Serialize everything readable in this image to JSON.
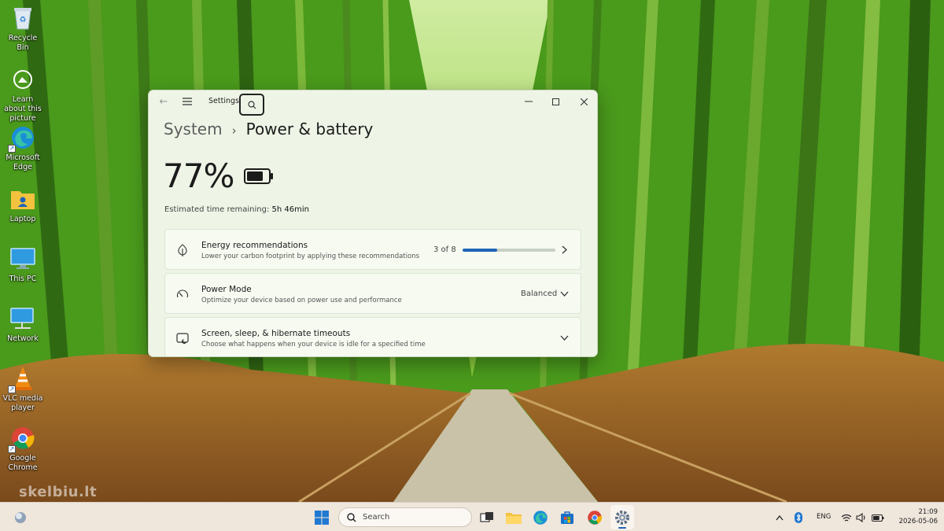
{
  "desktop": {
    "icons": [
      {
        "label": "Recycle Bin"
      },
      {
        "label": "Learn about this picture"
      },
      {
        "label": "Microsoft Edge"
      },
      {
        "label": "Laptop"
      },
      {
        "label": "This PC"
      },
      {
        "label": "Network"
      },
      {
        "label": "VLC media player"
      },
      {
        "label": "Google Chrome"
      }
    ],
    "watermark": "skelbiu.lt"
  },
  "window": {
    "app_title": "Settings",
    "breadcrumb": {
      "parent": "System",
      "separator": "›",
      "current": "Power & battery"
    },
    "battery": {
      "percent_text": "77%",
      "level": 0.77
    },
    "estimate": {
      "label": "Estimated time remaining:",
      "value": "5h 46min"
    },
    "cards": [
      {
        "title": "Energy recommendations",
        "subtitle": "Lower your carbon footprint by applying these recommendations",
        "value": "3 of 8",
        "progress": 0.375,
        "icon": "leaf-icon",
        "control": "chevron-right-icon"
      },
      {
        "title": "Power Mode",
        "subtitle": "Optimize your device based on power use and performance",
        "value": "Balanced",
        "icon": "gauge-icon",
        "control": "chevron-down-icon"
      },
      {
        "title": "Screen, sleep, & hibernate timeouts",
        "subtitle": "Choose what happens when your device is idle for a specified time",
        "value": "",
        "icon": "screen-sleep-icon",
        "control": "chevron-down-icon"
      }
    ]
  },
  "taskbar": {
    "search_placeholder": "Search",
    "language": "ENG",
    "time": "21:09",
    "date": "2026-05-06"
  },
  "colors": {
    "accent": "#1f63b8",
    "window_bg": "#eef5e6",
    "taskbar_bg": "#efe6dc"
  }
}
